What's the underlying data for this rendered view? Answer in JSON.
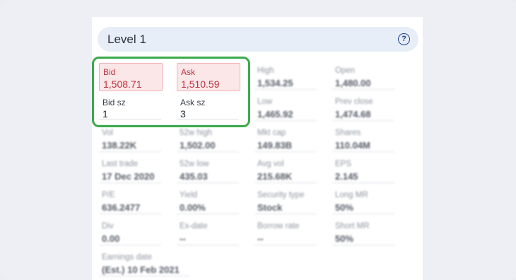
{
  "panel": {
    "title": "Level 1",
    "help_icon": "?"
  },
  "quote": {
    "bid": {
      "label": "Bid",
      "value": "1,508.71"
    },
    "ask": {
      "label": "Ask",
      "value": "1,510.59"
    },
    "bid_sz": {
      "label": "Bid sz",
      "value": "1"
    },
    "ask_sz": {
      "label": "Ask sz",
      "value": "3"
    }
  },
  "stats": {
    "high": {
      "label": "High",
      "value": "1,534.25"
    },
    "open": {
      "label": "Open",
      "value": "1,480.00"
    },
    "low": {
      "label": "Low",
      "value": "1,465.92"
    },
    "prev_close": {
      "label": "Prev close",
      "value": "1,474.68"
    },
    "vol": {
      "label": "Vol",
      "value": "138.22K"
    },
    "high_52w": {
      "label": "52w high",
      "value": "1,502.00"
    },
    "mkt_cap": {
      "label": "Mkt cap",
      "value": "149.83B"
    },
    "shares": {
      "label": "Shares",
      "value": "110.04M"
    },
    "last_trade": {
      "label": "Last trade",
      "value": "17 Dec 2020"
    },
    "low_52w": {
      "label": "52w low",
      "value": "435.03"
    },
    "avg_vol": {
      "label": "Avg vol",
      "value": "215.68K"
    },
    "eps": {
      "label": "EPS",
      "value": "2.145"
    },
    "pe": {
      "label": "P/E",
      "value": "636.2477"
    },
    "yield": {
      "label": "Yield",
      "value": "0.00%"
    },
    "security_type": {
      "label": "Security type",
      "value": "Stock"
    },
    "long_mr": {
      "label": "Long MR",
      "value": "50%"
    },
    "div": {
      "label": "Div",
      "value": "0.00"
    },
    "ex_date": {
      "label": "Ex-date",
      "value": "--"
    },
    "borrow_rate": {
      "label": "Borrow rate",
      "value": "--"
    },
    "short_mr": {
      "label": "Short MR",
      "value": "50%"
    },
    "earnings_date": {
      "label": "Earnings date",
      "value": "(Est.) 10 Feb 2021"
    }
  },
  "colors": {
    "highlight": "#3aaa4a",
    "quote_red": "#c0323f",
    "header_bg": "#e8eef8"
  }
}
